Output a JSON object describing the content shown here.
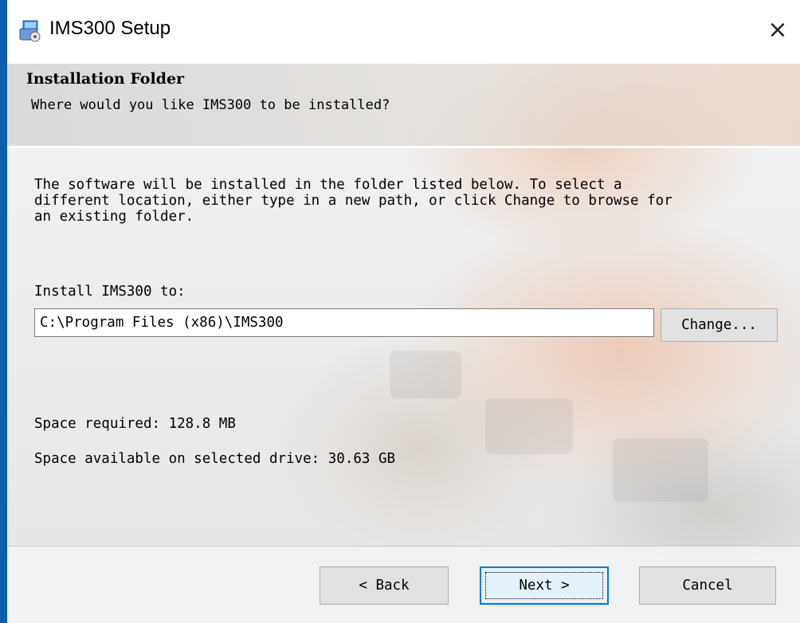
{
  "window": {
    "title": "IMS300 Setup",
    "close_glyph": "×",
    "icon": "installer-icon"
  },
  "header": {
    "heading": "Installation Folder",
    "subheading": "Where would you like IMS300 to be installed?"
  },
  "body": {
    "description": "The software will be installed in the folder listed below. To select a\ndifferent location, either type in a new path, or click Change to browse for\nan existing folder.",
    "install_label": "Install IMS300 to:",
    "install_path": "C:\\Program Files (x86)\\IMS300",
    "change_label": "Change...",
    "space_required": "Space required: 128.8 MB",
    "space_available": "Space available on selected drive: 30.63 GB"
  },
  "footer": {
    "back_label": "< Back",
    "next_label": "Next >",
    "cancel_label": "Cancel"
  },
  "colors": {
    "accent": "#0078d7",
    "window_border": "#0c5fa8"
  }
}
